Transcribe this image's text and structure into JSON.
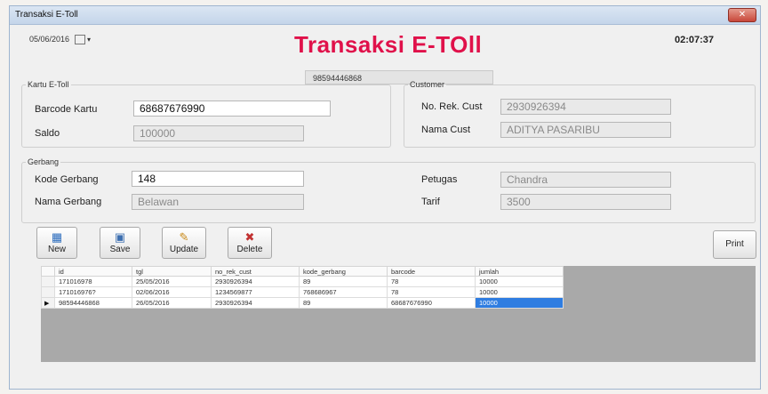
{
  "window": {
    "title": "Transaksi E-Toll",
    "close_label": "✕"
  },
  "header": {
    "date": "05/06/2016",
    "title": "Transaksi E-TOll",
    "clock": "02:07:37",
    "transaction_id": "98594446868"
  },
  "kartu": {
    "legend": "Kartu E-Toll",
    "barcode_label": "Barcode Kartu",
    "barcode_value": "68687676990",
    "saldo_label": "Saldo",
    "saldo_value": "100000"
  },
  "customer": {
    "legend": "Customer",
    "rek_label": "No. Rek. Cust",
    "rek_value": "2930926394",
    "nama_label": "Nama Cust",
    "nama_value": "ADITYA PASARIBU"
  },
  "gerbang": {
    "legend": "Gerbang",
    "kode_label": "Kode Gerbang",
    "kode_value": "148",
    "nama_label": "Nama Gerbang",
    "nama_value": "Belawan",
    "petugas_label": "Petugas",
    "petugas_value": "Chandra",
    "tarif_label": "Tarif",
    "tarif_value": "3500"
  },
  "toolbar": {
    "new_label": "New",
    "save_label": "Save",
    "update_label": "Update",
    "delete_label": "Delete",
    "print_label": "Print"
  },
  "grid": {
    "columns": [
      "id",
      "tgl",
      "no_rek_cust",
      "kode_gerbang",
      "barcode",
      "jumlah"
    ],
    "rows": [
      [
        "171016978",
        "25/05/2016",
        "2930926394",
        "89",
        "78",
        "10000"
      ],
      [
        "171016976?",
        "02/06/2016",
        "1234569877",
        "768686967",
        "78",
        "10000"
      ],
      [
        "98594446868",
        "26/05/2016",
        "2930926394",
        "89",
        "68687676990",
        "10000"
      ]
    ],
    "current_row_marker": "▶"
  },
  "colors": {
    "title_accent": "#e0114a",
    "selection": "#2f7de1"
  }
}
